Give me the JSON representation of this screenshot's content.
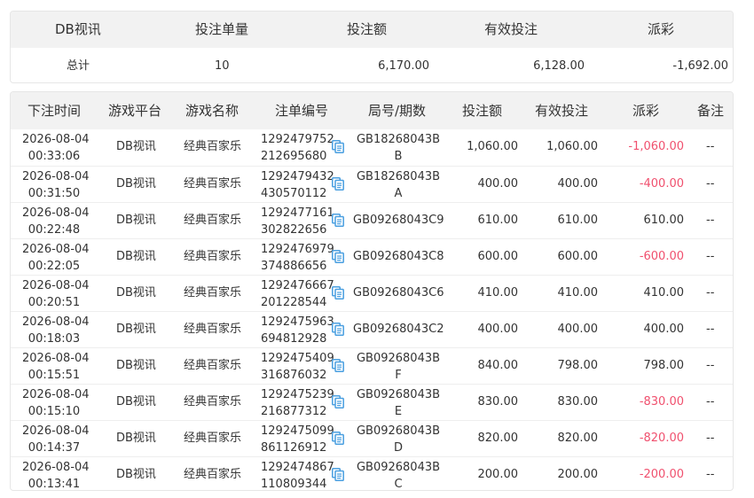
{
  "summary": {
    "headers": {
      "platform": "DB视讯",
      "count": "投注单量",
      "amount": "投注额",
      "valid": "有效投注",
      "payout": "派彩"
    },
    "totals": {
      "label": "总计",
      "count": "10",
      "amount": "6,170.00",
      "valid": "6,128.00",
      "payout": "-1,692.00"
    }
  },
  "table": {
    "headers": {
      "time": "下注时间",
      "platform": "游戏平台",
      "game": "游戏名称",
      "order": "注单编号",
      "round": "局号/期数",
      "amount": "投注额",
      "valid": "有效投注",
      "payout": "派彩",
      "note": "备注"
    },
    "rows": [
      {
        "date": "2026-08-04",
        "time": "00:33:06",
        "platform": "DB视讯",
        "game": "经典百家乐",
        "order1": "1292479752",
        "order2": "212695680",
        "round1": "GB18268043B",
        "round2": "B",
        "amount": "1,060.00",
        "valid": "1,060.00",
        "payout": "-1,060.00",
        "neg": true,
        "note": "--"
      },
      {
        "date": "2026-08-04",
        "time": "00:31:50",
        "platform": "DB视讯",
        "game": "经典百家乐",
        "order1": "1292479432",
        "order2": "430570112",
        "round1": "GB18268043B",
        "round2": "A",
        "amount": "400.00",
        "valid": "400.00",
        "payout": "-400.00",
        "neg": true,
        "note": "--"
      },
      {
        "date": "2026-08-04",
        "time": "00:22:48",
        "platform": "DB视讯",
        "game": "经典百家乐",
        "order1": "1292477161",
        "order2": "302822656",
        "round1": "GB09268043C9",
        "round2": "",
        "amount": "610.00",
        "valid": "610.00",
        "payout": "610.00",
        "neg": false,
        "note": "--"
      },
      {
        "date": "2026-08-04",
        "time": "00:22:05",
        "platform": "DB视讯",
        "game": "经典百家乐",
        "order1": "1292476979",
        "order2": "374886656",
        "round1": "GB09268043C8",
        "round2": "",
        "amount": "600.00",
        "valid": "600.00",
        "payout": "-600.00",
        "neg": true,
        "note": "--"
      },
      {
        "date": "2026-08-04",
        "time": "00:20:51",
        "platform": "DB视讯",
        "game": "经典百家乐",
        "order1": "1292476667",
        "order2": "201228544",
        "round1": "GB09268043C6",
        "round2": "",
        "amount": "410.00",
        "valid": "410.00",
        "payout": "410.00",
        "neg": false,
        "note": "--"
      },
      {
        "date": "2026-08-04",
        "time": "00:18:03",
        "platform": "DB视讯",
        "game": "经典百家乐",
        "order1": "1292475963",
        "order2": "694812928",
        "round1": "GB09268043C2",
        "round2": "",
        "amount": "400.00",
        "valid": "400.00",
        "payout": "400.00",
        "neg": false,
        "note": "--"
      },
      {
        "date": "2026-08-04",
        "time": "00:15:51",
        "platform": "DB视讯",
        "game": "经典百家乐",
        "order1": "1292475409",
        "order2": "316876032",
        "round1": "GB09268043B",
        "round2": "F",
        "amount": "840.00",
        "valid": "798.00",
        "payout": "798.00",
        "neg": false,
        "note": "--"
      },
      {
        "date": "2026-08-04",
        "time": "00:15:10",
        "platform": "DB视讯",
        "game": "经典百家乐",
        "order1": "1292475239",
        "order2": "216877312",
        "round1": "GB09268043B",
        "round2": "E",
        "amount": "830.00",
        "valid": "830.00",
        "payout": "-830.00",
        "neg": true,
        "note": "--"
      },
      {
        "date": "2026-08-04",
        "time": "00:14:37",
        "platform": "DB视讯",
        "game": "经典百家乐",
        "order1": "1292475099",
        "order2": "861126912",
        "round1": "GB09268043B",
        "round2": "D",
        "amount": "820.00",
        "valid": "820.00",
        "payout": "-820.00",
        "neg": true,
        "note": "--"
      },
      {
        "date": "2026-08-04",
        "time": "00:13:41",
        "platform": "DB视讯",
        "game": "经典百家乐",
        "order1": "1292474867",
        "order2": "110809344",
        "round1": "GB09268043B",
        "round2": "C",
        "amount": "200.00",
        "valid": "200.00",
        "payout": "-200.00",
        "neg": true,
        "note": "--"
      }
    ]
  },
  "colors": {
    "negative": "#f0506e",
    "header_bg": "#f2f2f2",
    "copy_icon": "#4a9fe0"
  },
  "icons": {
    "copy": "copy-icon"
  }
}
